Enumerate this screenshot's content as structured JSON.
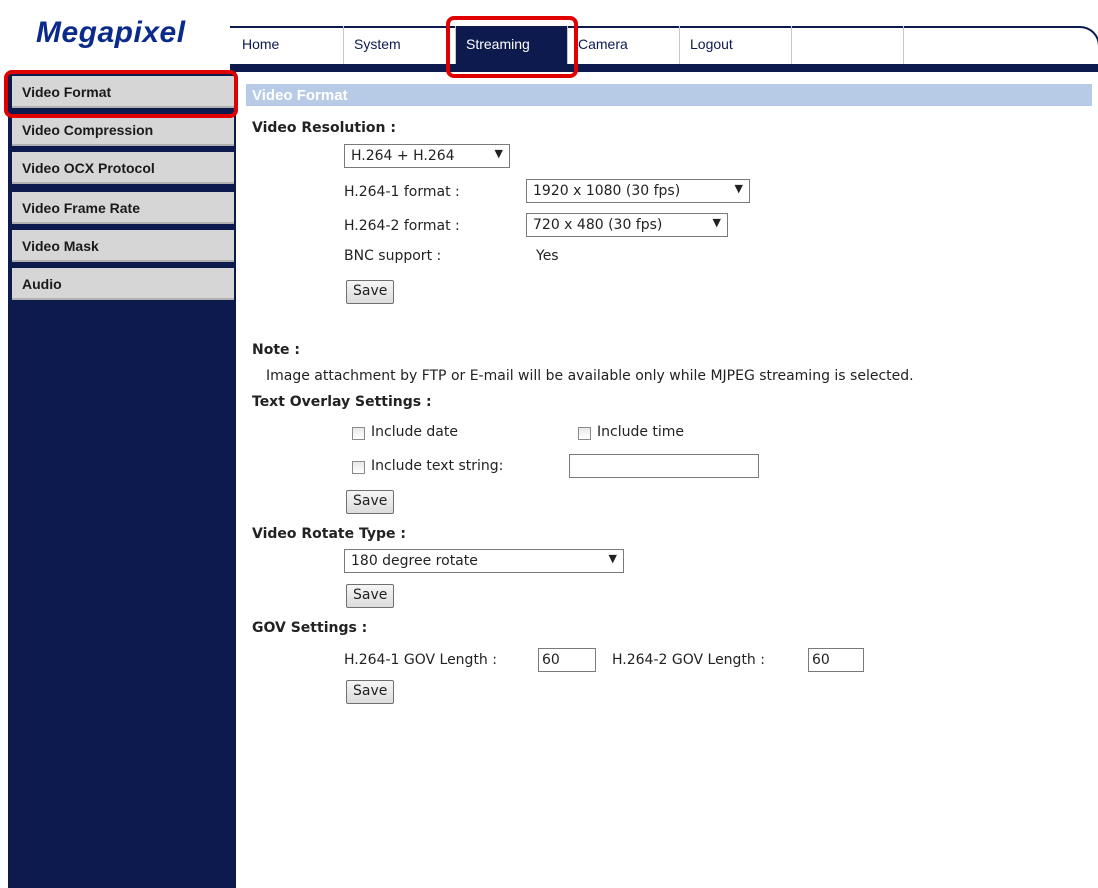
{
  "brand": {
    "logo": "Megapixel"
  },
  "nav": {
    "tabs": [
      {
        "label": "Home",
        "active": false
      },
      {
        "label": "System",
        "active": false
      },
      {
        "label": "Streaming",
        "active": true
      },
      {
        "label": "Camera",
        "active": false
      },
      {
        "label": "Logout",
        "active": false
      }
    ]
  },
  "sidebar": {
    "items": [
      {
        "label": "Video Format"
      },
      {
        "label": "Video Compression"
      },
      {
        "label": "Video OCX Protocol"
      },
      {
        "label": "Video Frame Rate"
      },
      {
        "label": "Video Mask"
      },
      {
        "label": "Audio"
      }
    ]
  },
  "main": {
    "section_title": "Video Format",
    "video_resolution": {
      "heading": "Video Resolution :",
      "mode_value": "H.264 + H.264",
      "h264_1_label": "H.264-1 format :",
      "h264_1_value": "1920 x 1080 (30 fps)",
      "h264_2_label": "H.264-2 format :",
      "h264_2_value": "720 x 480 (30 fps)",
      "bnc_label": "BNC support :",
      "bnc_value": "Yes",
      "save_label": "Save"
    },
    "note": {
      "heading": "Note :",
      "text": "Image attachment by FTP or E-mail will be available only while MJPEG streaming is selected."
    },
    "text_overlay": {
      "heading": "Text Overlay Settings :",
      "include_date_label": "Include date",
      "include_date_checked": false,
      "include_time_label": "Include time",
      "include_time_checked": false,
      "include_text_label": "Include text string:",
      "include_text_checked": false,
      "text_value": "",
      "save_label": "Save"
    },
    "video_rotate": {
      "heading": "Video Rotate Type :",
      "value": "180 degree rotate",
      "save_label": "Save"
    },
    "gov": {
      "heading": "GOV Settings :",
      "h264_1_label": "H.264-1 GOV Length :",
      "h264_1_value": "60",
      "h264_2_label": "H.264-2 GOV Length :",
      "h264_2_value": "60",
      "save_label": "Save"
    }
  },
  "colors": {
    "navy": "#0d1a4e",
    "logo": "#0a2a8c",
    "highlight": "#e00000",
    "section_bar": "#b8cbe6"
  }
}
